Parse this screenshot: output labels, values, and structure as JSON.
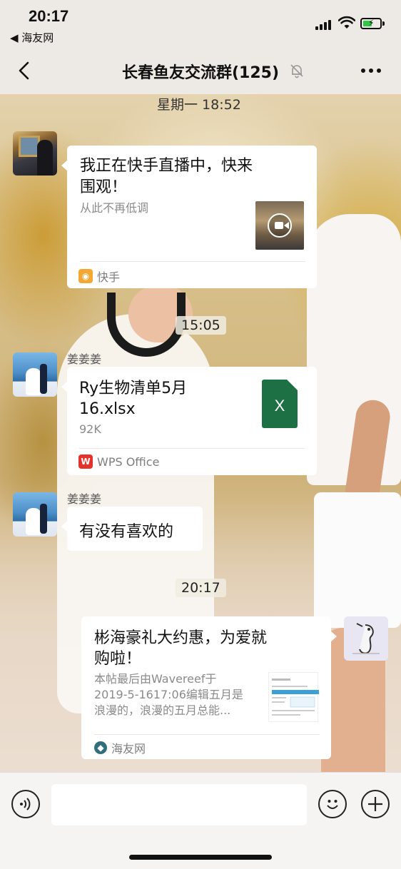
{
  "status_bar": {
    "time": "20:17",
    "back_app": "◀ 海友网",
    "signal_icon": "cellular-signal-icon",
    "wifi_icon": "wifi-icon",
    "battery_icon": "battery-charging-icon",
    "battery_color": "#32c648"
  },
  "nav": {
    "back_icon": "chevron-left-icon",
    "title": "长春鱼友交流群(125)",
    "mute_icon": "bell-muted-icon",
    "more_icon": "more-dots-icon"
  },
  "messages": {
    "ts1": "星期一 18:52",
    "msg1": {
      "title_line1": "我正在快手直播中，快来",
      "title_line2": "围观！",
      "desc": "从此不再低调",
      "source": "快手",
      "source_color": "#f3a833"
    },
    "ts2": "15:05",
    "msg2": {
      "sender": "姜姜姜",
      "file_line1": "Ry生物清单5月",
      "file_line2": "16.xlsx",
      "size": "92K",
      "file_icon_label": "X",
      "source": "WPS  Office",
      "source_color": "#e5322d"
    },
    "msg3": {
      "sender": "姜姜姜",
      "text": "有没有喜欢的"
    },
    "ts3": "20:17",
    "msg4": {
      "title_line1": "彬海豪礼大约惠，为爱就",
      "title_line2": "购啦！",
      "desc_line1": "本帖最后由Wavereef于",
      "desc_line2": "2019-5-1617:06编辑五月是",
      "desc_line3": "浪漫的，浪漫的五月总能...",
      "source": "海友网",
      "source_color": "#2f6f7d"
    }
  },
  "input_bar": {
    "voice_icon": "voice-icon",
    "emoji_icon": "emoji-icon",
    "add_icon": "plus-circle-icon",
    "input_value": ""
  }
}
